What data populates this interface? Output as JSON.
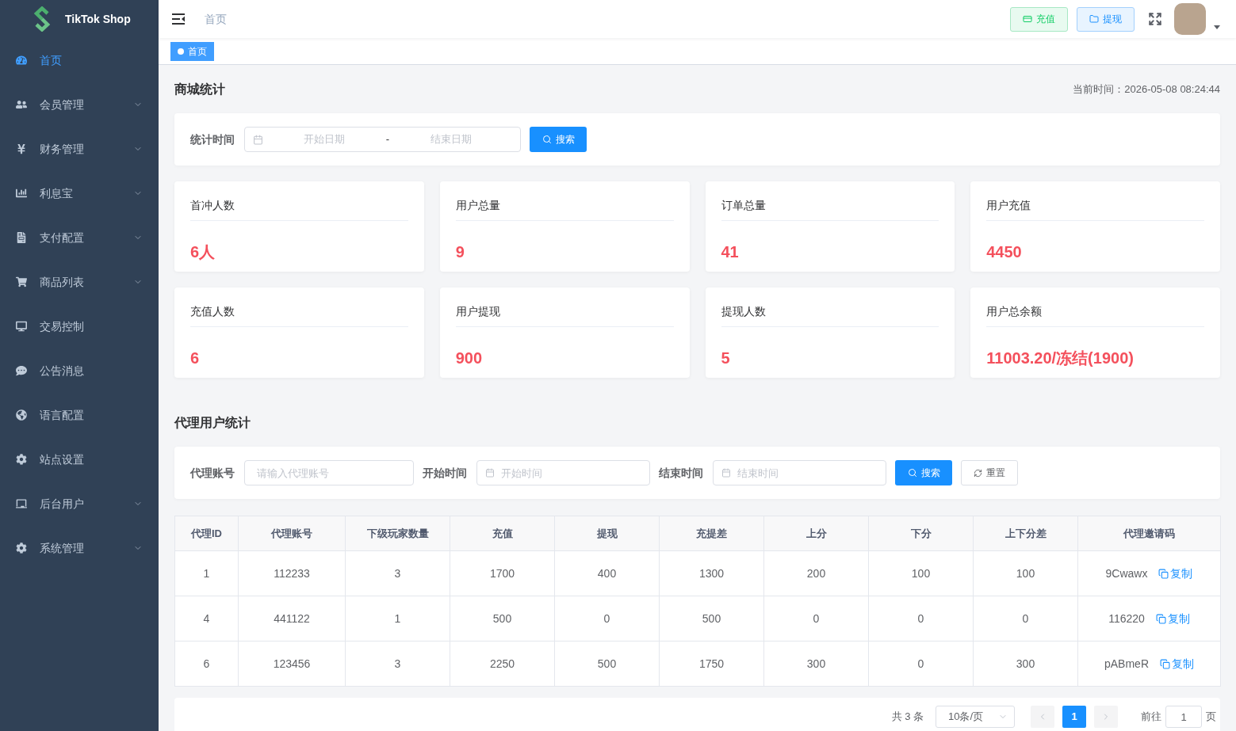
{
  "sidebar": {
    "logo_text": "TikTok Shop",
    "items": [
      {
        "label": "首页",
        "kind": "link",
        "selected": true
      },
      {
        "label": "会员管理",
        "kind": "group",
        "selected": false
      },
      {
        "label": "财务管理",
        "kind": "group",
        "selected": false
      },
      {
        "label": "利息宝",
        "kind": "group",
        "selected": false
      },
      {
        "label": "支付配置",
        "kind": "group",
        "selected": false
      },
      {
        "label": "商品列表",
        "kind": "group",
        "selected": false
      },
      {
        "label": "交易控制",
        "kind": "link",
        "selected": false
      },
      {
        "label": "公告消息",
        "kind": "link",
        "selected": false
      },
      {
        "label": "语言配置",
        "kind": "link",
        "selected": false
      },
      {
        "label": "站点设置",
        "kind": "link",
        "selected": false
      },
      {
        "label": "后台用户",
        "kind": "group",
        "selected": false
      },
      {
        "label": "系统管理",
        "kind": "group",
        "selected": false
      }
    ]
  },
  "header": {
    "breadcrumb": "首页",
    "buttons": [
      {
        "label": "充值",
        "kind": "success"
      },
      {
        "label": "提现",
        "kind": "primary"
      }
    ]
  },
  "tags": [
    {
      "label": "首页",
      "selected": true
    }
  ],
  "shop_stats": {
    "title": "商城统计",
    "current_time": "当前时间：2026-05-08 08:24:44",
    "filter": {
      "label": "统计时间",
      "start_placeholder": "开始日期",
      "separator": "-",
      "end_placeholder": "结束日期",
      "search_button": "搜索"
    },
    "cards": [
      {
        "label": "首冲人数",
        "value": "6人"
      },
      {
        "label": "用户总量",
        "value": "9"
      },
      {
        "label": "订单总量",
        "value": "41"
      },
      {
        "label": "用户充值",
        "value": "4450"
      },
      {
        "label": "充值人数",
        "value": "6"
      },
      {
        "label": "用户提现",
        "value": "900"
      },
      {
        "label": "提现人数",
        "value": "5"
      },
      {
        "label": "用户总余额",
        "value": "11003.20/冻结(1900)"
      }
    ]
  },
  "agent_stats": {
    "title": "代理用户统计",
    "filter": {
      "fields": [
        {
          "label": "代理账号",
          "placeholder": "请输入代理账号",
          "kind": "text"
        },
        {
          "label": "开始时间",
          "placeholder": "开始时间",
          "kind": "date"
        },
        {
          "label": "结束时间",
          "placeholder": "结束时间",
          "kind": "date"
        }
      ],
      "search_button": "搜索",
      "reset_button": "重置"
    },
    "table": {
      "columns": [
        "代理ID",
        "代理账号",
        "下级玩家数量",
        "充值",
        "提现",
        "充提差",
        "上分",
        "下分",
        "上下分差",
        "代理邀请码"
      ],
      "rows": [
        {
          "cells": [
            "1",
            "112233",
            "3",
            "1700",
            "400",
            "1300",
            "200",
            "100",
            "100"
          ],
          "invite_code": "9Cwawx",
          "copy_link": "复制"
        },
        {
          "cells": [
            "4",
            "441122",
            "1",
            "500",
            "0",
            "500",
            "0",
            "0",
            "0"
          ],
          "invite_code": "116220",
          "copy_link": "复制"
        },
        {
          "cells": [
            "6",
            "123456",
            "3",
            "2250",
            "500",
            "1750",
            "300",
            "0",
            "300"
          ],
          "invite_code": "pABmeR",
          "copy_link": "复制"
        }
      ]
    },
    "pagination": {
      "total": "共 3 条",
      "page_size": "10条/页",
      "pages": [
        {
          "label": "1",
          "selected": true
        }
      ],
      "goto_label": "前往",
      "goto_value": "1",
      "page_suffix": "页"
    }
  }
}
